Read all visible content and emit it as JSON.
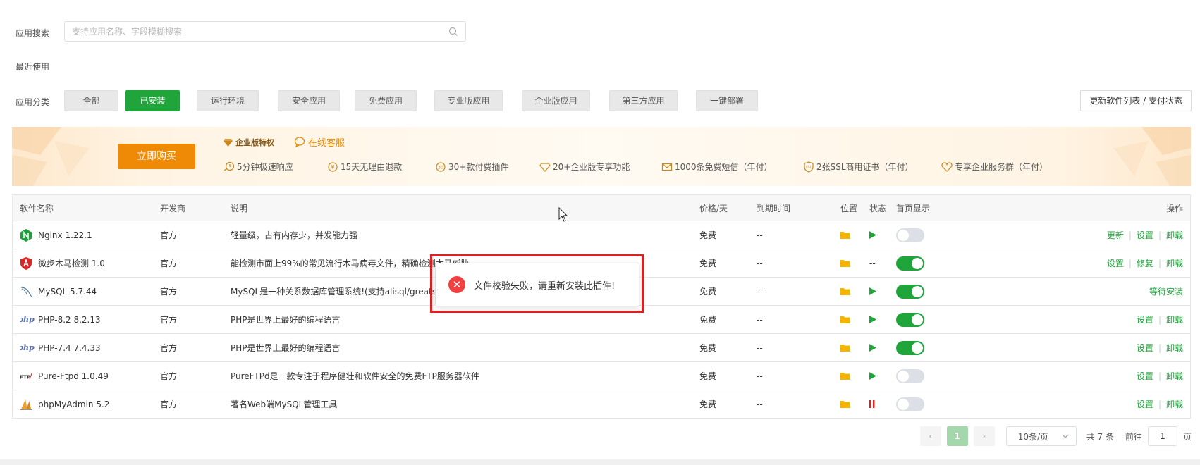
{
  "search": {
    "label": "应用搜索",
    "placeholder": "支持应用名称、字段模糊搜索",
    "value": ""
  },
  "recent": {
    "label": "最近使用"
  },
  "categories": {
    "label": "应用分类",
    "items": [
      {
        "label": "全部",
        "active": false
      },
      {
        "label": "已安装",
        "active": true
      },
      {
        "label": "运行环境",
        "active": false
      },
      {
        "label": "安全应用",
        "active": false
      },
      {
        "label": "免费应用",
        "active": false
      },
      {
        "label": "专业版应用",
        "active": false
      },
      {
        "label": "企业版应用",
        "active": false
      },
      {
        "label": "第三方应用",
        "active": false
      },
      {
        "label": "一键部署",
        "active": false
      }
    ],
    "refresh_label": "更新软件列表 / 支付状态"
  },
  "banner": {
    "buy_label": "立即购买",
    "enterprise_title": "企业版特权",
    "service_label": "在线客服",
    "features": [
      {
        "icon": "fast-response-icon",
        "label": "5分钟极速响应"
      },
      {
        "icon": "refund-icon",
        "label": "15天无理由退款"
      },
      {
        "icon": "plugin-icon",
        "label": "30+款付费插件"
      },
      {
        "icon": "diamond-icon",
        "label": "20+企业版专享功能"
      },
      {
        "icon": "mail-icon",
        "label": "1000条免费短信（年付）"
      },
      {
        "icon": "ssl-icon",
        "label": "2张SSL商用证书（年付）"
      },
      {
        "icon": "heart-icon",
        "label": "专享企业服务群（年付）"
      }
    ],
    "colors": {
      "accent": "#ee8a06",
      "title": "#8a5a14"
    }
  },
  "table": {
    "headers": {
      "name": "软件名称",
      "developer": "开发商",
      "description": "说明",
      "price": "价格/天",
      "expire": "到期时间",
      "location": "位置",
      "status": "状态",
      "home": "首页显示",
      "ops": "操作"
    },
    "rows": [
      {
        "icon": "nginx-icon",
        "name": "Nginx 1.22.1",
        "developer": "官方",
        "description": "轻量级，占有内存少，并发能力强",
        "price": "免费",
        "expire": "--",
        "status": "play",
        "status_text": "",
        "home": false,
        "ops": [
          "更新",
          "设置",
          "卸载"
        ]
      },
      {
        "icon": "shield-icon",
        "name": "微步木马检测 1.0",
        "developer": "官方",
        "description": "能检测市面上99%的常见流行木马病毒文件，精确检测木马威胁",
        "price": "免费",
        "expire": "--",
        "status": "text",
        "status_text": "--",
        "home": true,
        "ops": [
          "设置",
          "修复",
          "卸载"
        ]
      },
      {
        "icon": "mysql-icon",
        "name": "MySQL 5.7.44",
        "developer": "官方",
        "description": "MySQL是一种关系数据库管理系统!(支持alisql/greatsql)",
        "price": "免费",
        "expire": "--",
        "status": "play",
        "status_text": "",
        "home": true,
        "ops": [
          "等待安装"
        ]
      },
      {
        "icon": "php-icon",
        "name": "PHP-8.2 8.2.13",
        "developer": "官方",
        "description": "PHP是世界上最好的编程语言",
        "price": "免费",
        "expire": "--",
        "status": "play",
        "status_text": "",
        "home": true,
        "ops": [
          "设置",
          "卸载"
        ]
      },
      {
        "icon": "php-icon",
        "name": "PHP-7.4 7.4.33",
        "developer": "官方",
        "description": "PHP是世界上最好的编程语言",
        "price": "免费",
        "expire": "--",
        "status": "play",
        "status_text": "",
        "home": true,
        "ops": [
          "设置",
          "卸载"
        ]
      },
      {
        "icon": "ftp-icon",
        "name": "Pure-Ftpd 1.0.49",
        "developer": "官方",
        "description": "PureFTPd是一款专注于程序健壮和软件安全的免费FTP服务器软件",
        "price": "免费",
        "expire": "--",
        "status": "play",
        "status_text": "",
        "home": false,
        "ops": [
          "设置",
          "卸载"
        ]
      },
      {
        "icon": "phpmyadmin-icon",
        "name": "phpMyAdmin 5.2",
        "developer": "官方",
        "description": "著名Web端MySQL管理工具",
        "price": "免费",
        "expire": "--",
        "status": "pause",
        "status_text": "",
        "home": false,
        "ops": [
          "设置",
          "卸载"
        ]
      }
    ],
    "php_logo_text": "php",
    "ftp_logo_text": "FTP"
  },
  "toast": {
    "message": "文件校验失败，请重新安装此插件!",
    "icon": "error-icon"
  },
  "pagination": {
    "current": "1",
    "page_size": "10条/页",
    "total": "共 7 条",
    "goto_label": "前往",
    "goto_value": "1",
    "page_suffix": "页"
  },
  "colors": {
    "primary": "#20a53a",
    "folder": "#f5b400",
    "pause": "#e02020",
    "error": "#f04040"
  }
}
